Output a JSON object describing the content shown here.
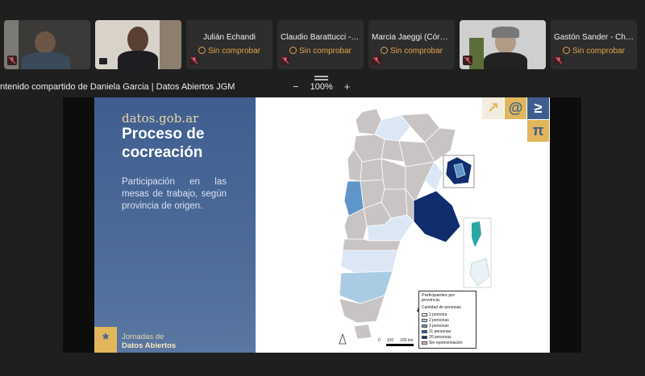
{
  "participants": [
    {
      "type": "video",
      "name": "",
      "mic": "muted"
    },
    {
      "type": "video",
      "name": "",
      "mic": "screen-share"
    },
    {
      "type": "name",
      "name": "Julián Echandi",
      "status": "Sin comprobar",
      "mic": "muted"
    },
    {
      "type": "name",
      "name": "Claudio Barattucci -G...",
      "status": "Sin comprobar",
      "mic": "muted"
    },
    {
      "type": "name",
      "name": "Marcia Jaeggi (Córdo...",
      "status": "Sin comprobar",
      "mic": "muted"
    },
    {
      "type": "video",
      "name": "",
      "mic": "muted"
    },
    {
      "type": "name",
      "name": "Gastón Sander - Chu...",
      "status": "Sin comprobar",
      "mic": "muted"
    }
  ],
  "sharebar": {
    "title": "ntenido compartido de Daniela Garcia | Datos Abiertos JGM",
    "zoom_out": "−",
    "zoom_level": "100%",
    "zoom_in": "+"
  },
  "slide": {
    "brand": "datos.gob.ar",
    "title": "Proceso de cocreación",
    "subtitle": "Participación en las mesas de trabajo, según provincia de origen.",
    "badge": "*",
    "footer_line1": "Jornadas de",
    "footer_line2": "Datos Abiertos",
    "icons": {
      "arrow": "↗",
      "at": "@",
      "geq": "≥",
      "pi": "π"
    },
    "legend": {
      "title": "Participantes por provincia",
      "subtitle": "Cantidad de personas",
      "items": [
        {
          "label": "1 persona",
          "color": "#dbe7f4"
        },
        {
          "label": "2 personas",
          "color": "#a9cbe3"
        },
        {
          "label": "3 personas",
          "color": "#5f95c9"
        },
        {
          "label": "11 personas",
          "color": "#2a5aa3"
        },
        {
          "label": "20 personas",
          "color": "#102d6d"
        },
        {
          "label": "Sin representación",
          "color": "#c9c4c4"
        }
      ]
    },
    "scale": {
      "start": "0",
      "mid": "100",
      "end": "200 km"
    }
  },
  "colors": {
    "accent": "#e6a24a",
    "panel": "#3f5e8f",
    "gold": "#e2b65a"
  }
}
